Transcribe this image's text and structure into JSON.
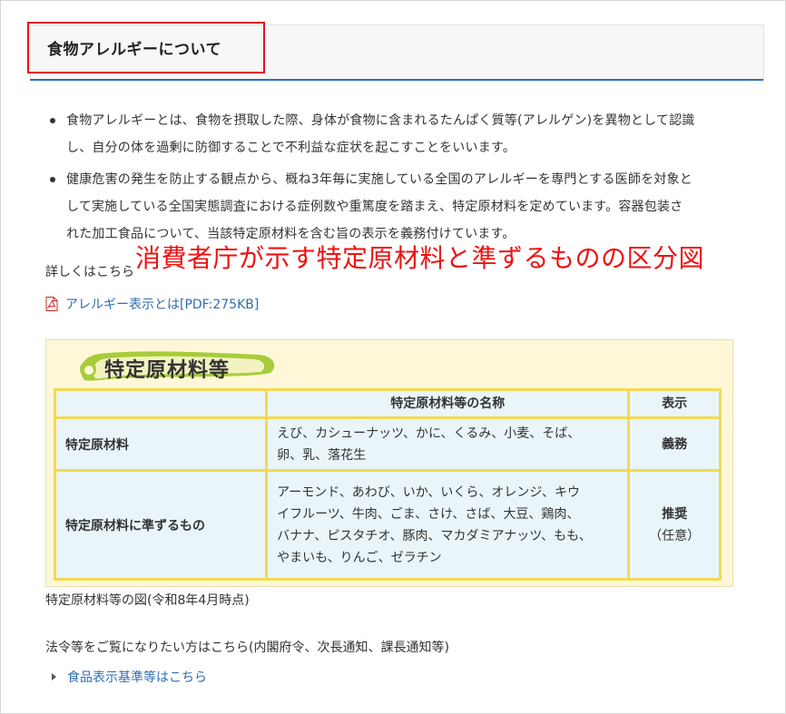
{
  "heading": {
    "title": "食物アレルギーについて"
  },
  "bullets": [
    {
      "lines": [
        "食物アレルギーとは、食物を摂取した際、身体が食物に含まれるたんぱく質等(アレルゲン)を異物として認識",
        "し、自分の体を過剰に防御することで不利益な症状を起こすことをいいます。"
      ]
    },
    {
      "lines": [
        "健康危害の発生を防止する観点から、概ね3年毎に実施している全国のアレルギーを専門とする医師を対象と",
        "して実施している全国実態調査における症例数や重篤度を踏まえ、特定原材料を定めています。容器包装さ",
        "れた加工食品について、当該特定原材料を含む旨の表示を義務付けています。"
      ]
    }
  ],
  "overlay_caption": "消費者庁が示す特定原材料と準ずるものの区分図",
  "details_label": "詳しくはこちら",
  "pdf_link": {
    "label": "アレルギー表示とは[PDF:275KB]",
    "icon": "pdf-icon"
  },
  "figure": {
    "title": "特定原材料等",
    "headers": [
      "",
      "特定原材料等の名称",
      "表示"
    ],
    "rows": [
      {
        "category": "特定原材料",
        "names": [
          "えび、カシューナッツ、かに、くるみ、小麦、そば、",
          "卵、乳、落花生"
        ],
        "label": [
          "義務"
        ]
      },
      {
        "category": "特定原材料に準ずるもの",
        "names": [
          "アーモンド、あわび、いか、いくら、オレンジ、キウ",
          "イフルーツ、牛肉、ごま、さけ、さば、大豆、鶏肉、",
          "バナナ、ピスタチオ、豚肉、マカダミアナッツ、もも、",
          "やまいも、りんご、ゼラチン"
        ],
        "label": [
          "推奨",
          "（任意）"
        ]
      }
    ],
    "colors": {
      "border": "#f2da53",
      "cell_bg": "#e9f5f9",
      "bg": "#fff8d8",
      "brush": "#a6cc3a"
    }
  },
  "figure_caption": "特定原材料等の図(令和8年4月時点)",
  "laws_label": "法令等をご覧になりたい方はこちら(内閣府令、次長通知、課長通知等)",
  "std_link": {
    "label": "食品表示基準等はこちら",
    "icon": "triangle-right-icon"
  },
  "colors": {
    "accent": "#2d6fb4",
    "highlight_red": "#e3121b",
    "link": "#2f6db3"
  }
}
